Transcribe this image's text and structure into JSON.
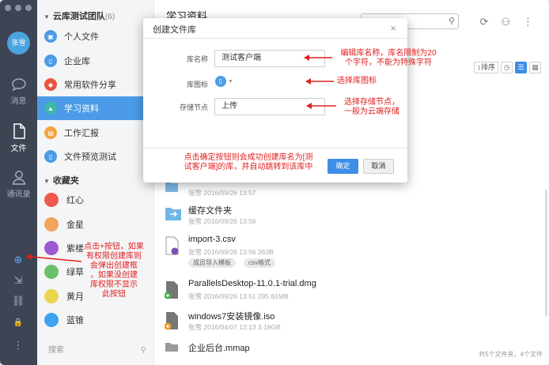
{
  "rail": {
    "avatar_text": "张雪",
    "nav": [
      {
        "label": "消息",
        "icon": "chat-icon"
      },
      {
        "label": "文件",
        "icon": "file-icon"
      },
      {
        "label": "通讯录",
        "icon": "contacts-icon"
      }
    ],
    "tools": [
      {
        "icon": "add-circle-icon",
        "glyph": "⊕"
      },
      {
        "icon": "export-icon",
        "glyph": "⇲"
      },
      {
        "icon": "link-icon",
        "glyph": "⛓"
      },
      {
        "icon": "lock-icon",
        "glyph": "🔒"
      },
      {
        "icon": "more-vertical-icon",
        "glyph": "⋮"
      }
    ]
  },
  "libs": {
    "team_name": "云库测试团队",
    "team_count": "(6)",
    "items": [
      {
        "label": "个人文件",
        "color": "#4b9be8",
        "glyph": "▣"
      },
      {
        "label": "企业库",
        "color": "#4b9be8",
        "glyph": "▯"
      },
      {
        "label": "常用软件分享",
        "color": "#e8553f",
        "glyph": "◆"
      },
      {
        "label": "学习资料",
        "color": "#3fb8a8",
        "glyph": "▲"
      },
      {
        "label": "工作汇报",
        "color": "#f2a33a",
        "glyph": "▤"
      },
      {
        "label": "文件预览测试",
        "color": "#4b9be8",
        "glyph": "▯"
      }
    ],
    "fav_head": "收藏夹",
    "favs": [
      {
        "label": "红心",
        "color": "#ee5a4d"
      },
      {
        "label": "金星",
        "color": "#f2a35b"
      },
      {
        "label": "紫楼",
        "color": "#9b59d0"
      },
      {
        "label": "绿草",
        "color": "#6cc06a"
      },
      {
        "label": "黄月",
        "color": "#e9d64e"
      },
      {
        "label": "蓝锥",
        "color": "#3fa3ef"
      }
    ],
    "search_placeholder": "搜索"
  },
  "main": {
    "title": "学习资料",
    "sort_label": "排序",
    "files": [
      {
        "name": "",
        "meta": "张雪   2016/09/26 13:57",
        "icon": "folder-icon",
        "tags": []
      },
      {
        "name": "缓存文件夹",
        "meta": "张雪   2016/09/26 13:56",
        "icon": "folder-icon",
        "tags": []
      },
      {
        "name": "import-3.csv",
        "meta": "张雪   2016/09/26 13:56   263B",
        "icon": "csv-file-icon",
        "tags": [
          "成员导入模板",
          "csv格式"
        ]
      },
      {
        "name": "ParallelsDesktop-11.0.1-trial.dmg",
        "meta": "张雪   2016/09/26 13:51   295.81MB",
        "icon": "dmg-file-icon",
        "tags": []
      },
      {
        "name": "windows7安装镜像.iso",
        "meta": "张雪   2016/04/07 12:13   3.19GB",
        "icon": "iso-file-icon",
        "tags": []
      },
      {
        "name": "企业后台.mmap",
        "meta": "",
        "icon": "mmap-file-icon",
        "tags": []
      }
    ],
    "footer": "共5个文件夹，4个文件"
  },
  "modal": {
    "title": "创建文件库",
    "name_label": "库名称",
    "name_value": "测试客户端",
    "icon_label": "库图标",
    "node_label": "存储节点",
    "node_value": "上传",
    "ok": "确定",
    "cancel": "取消"
  },
  "notes": {
    "name_note": "编辑库名称，库名限制为20\n个字符，不能为特殊字符",
    "icon_note": "选择库图标",
    "node_note": "选择存储节点，\n一般为云端存储",
    "confirm_note": "点击确定按钮则会成功创建库名为[测\n试客户端]的库，并自动跳转到该库中",
    "plus_note": "点击+按钮，如果\n有权限创建库则\n会弹出创建框\n，如果没创建\n库权限不显示\n此按钮"
  }
}
